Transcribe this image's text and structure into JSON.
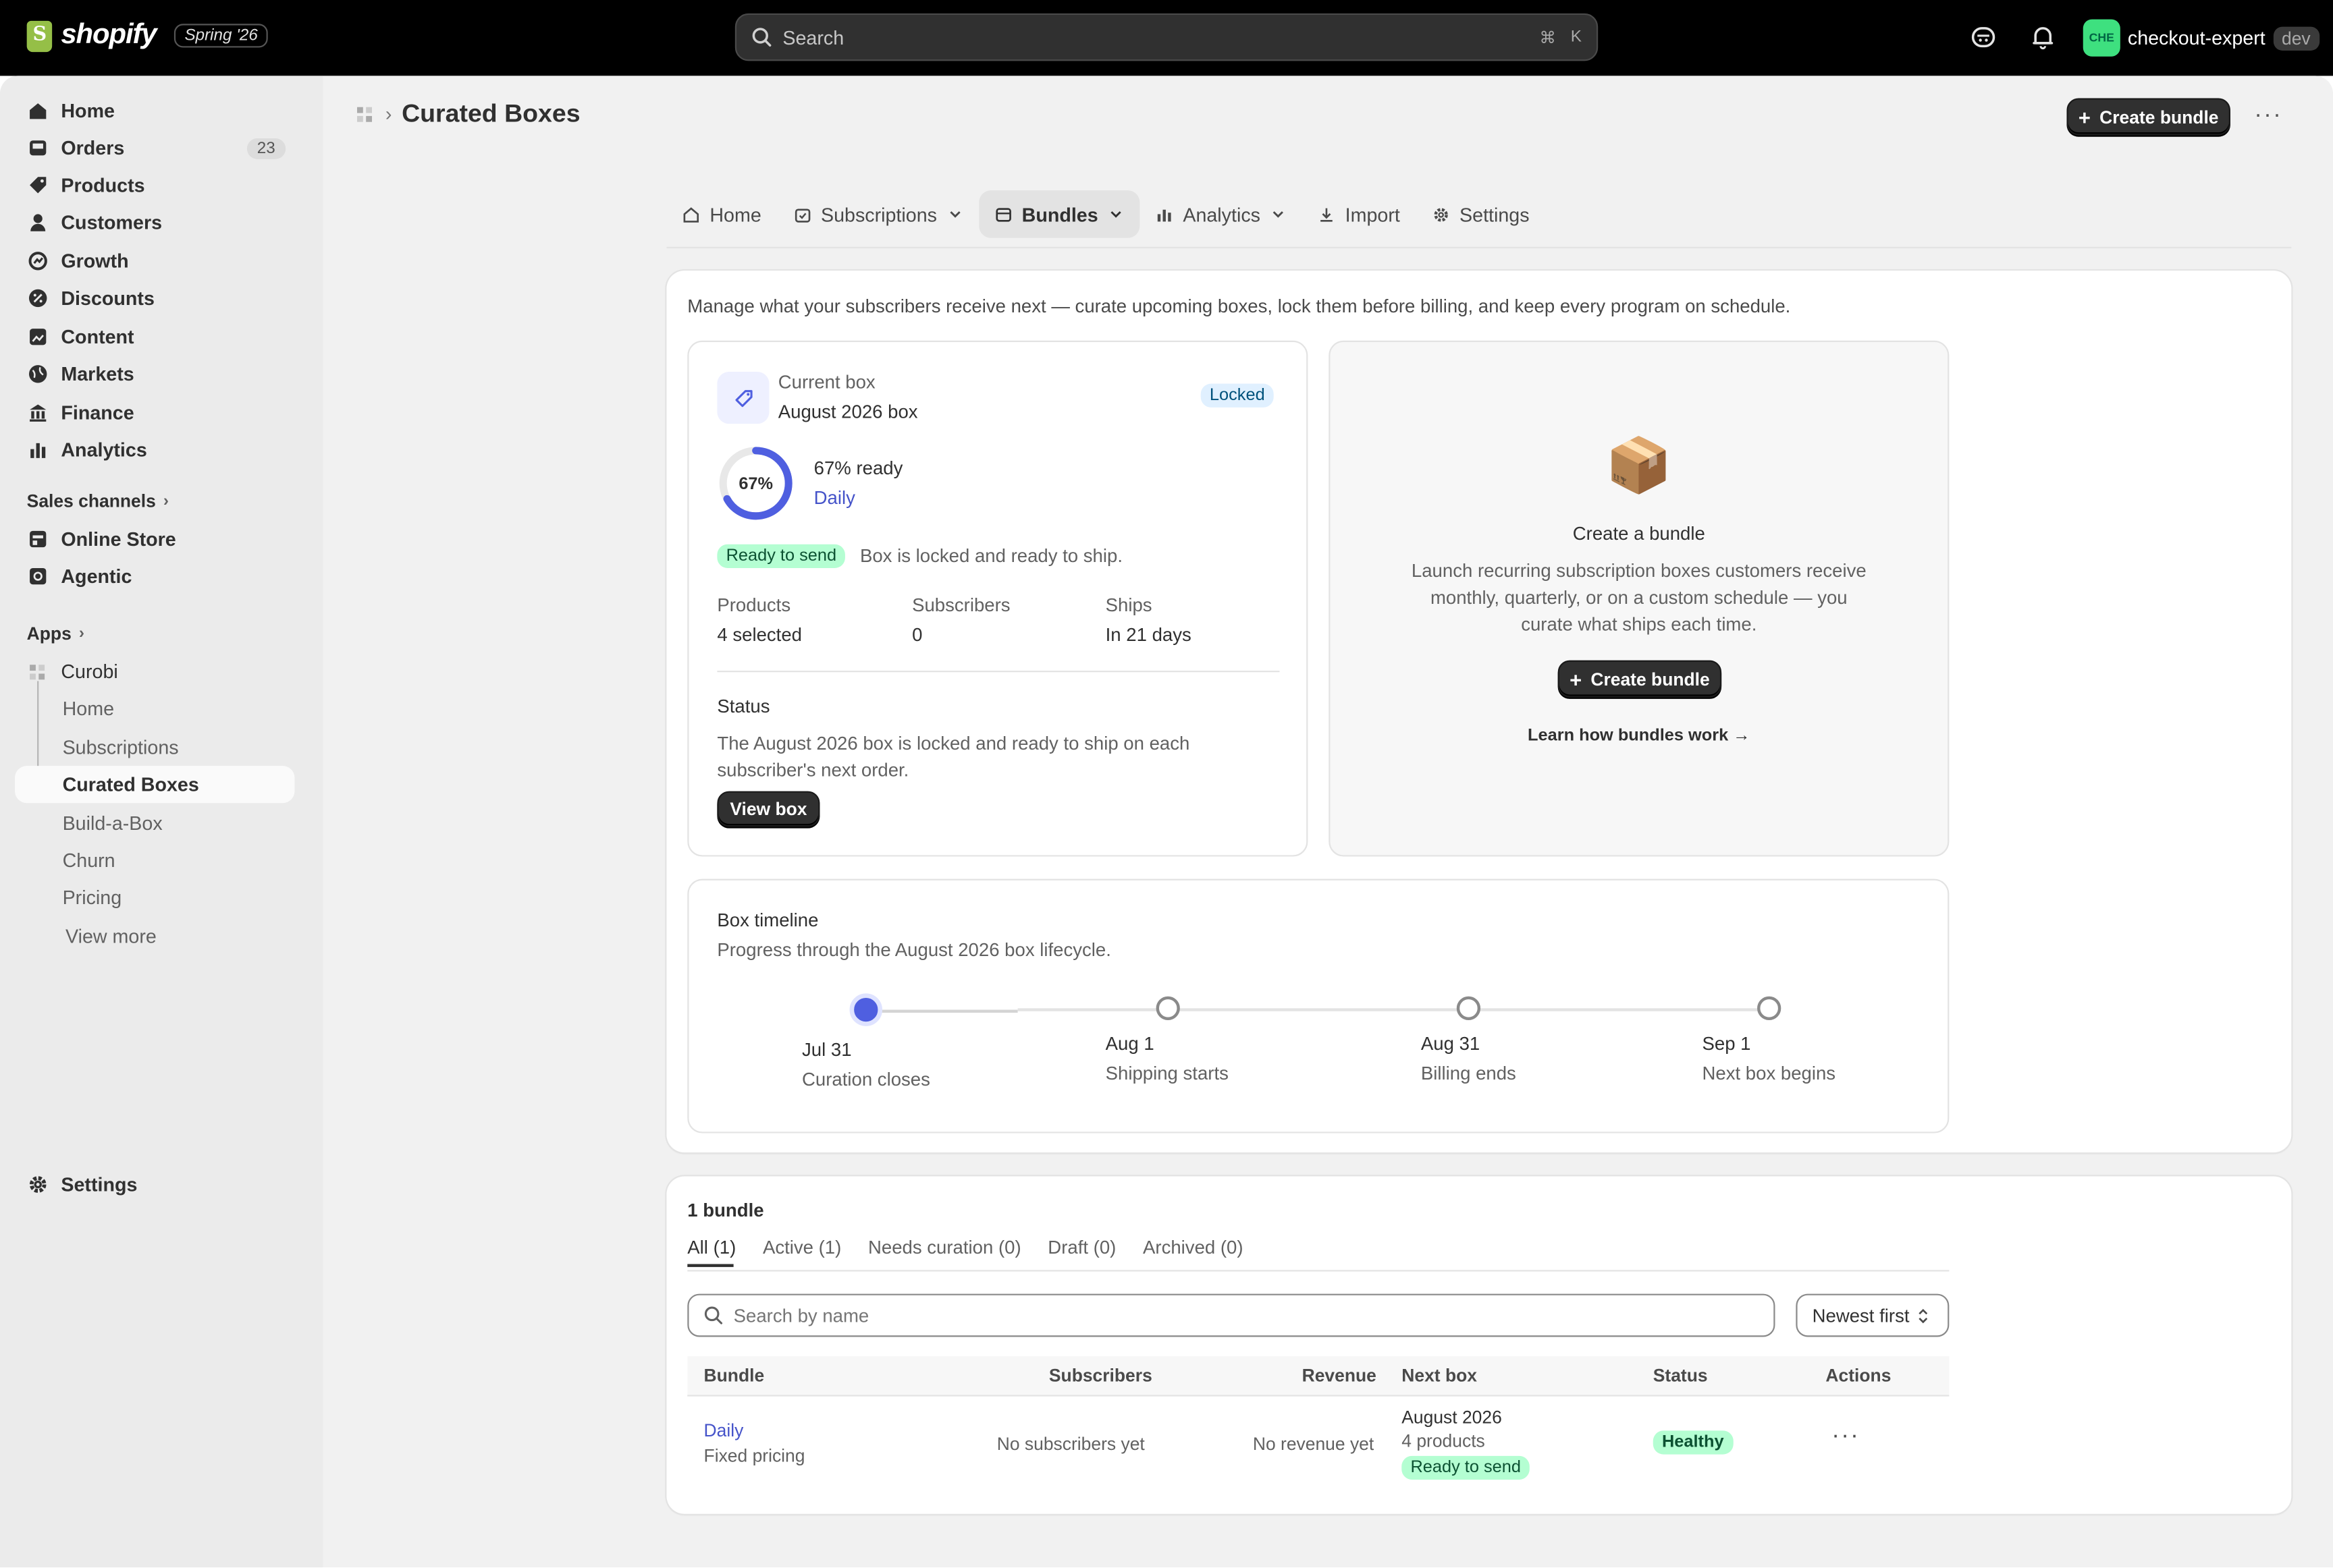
{
  "topbar": {
    "brand": "shopify",
    "release": "Spring '26",
    "search_placeholder": "Search",
    "shortcut_cmd": "⌘",
    "shortcut_key": "K",
    "store_avatar": "CHE",
    "store_name": "checkout-expert",
    "store_env": "dev"
  },
  "sidebar": {
    "items": [
      {
        "label": "Home",
        "icon": "home-icon"
      },
      {
        "label": "Orders",
        "icon": "inbox-icon",
        "badge": "23"
      },
      {
        "label": "Products",
        "icon": "tag-icon"
      },
      {
        "label": "Customers",
        "icon": "person-icon"
      },
      {
        "label": "Growth",
        "icon": "growth-icon"
      },
      {
        "label": "Discounts",
        "icon": "discount-icon"
      },
      {
        "label": "Content",
        "icon": "content-icon"
      },
      {
        "label": "Markets",
        "icon": "globe-icon"
      },
      {
        "label": "Finance",
        "icon": "bank-icon"
      },
      {
        "label": "Analytics",
        "icon": "bar-chart-icon"
      }
    ],
    "sales_channels_label": "Sales channels",
    "channels": [
      {
        "label": "Online Store",
        "icon": "store-icon"
      },
      {
        "label": "Agentic",
        "icon": "agentic-icon"
      }
    ],
    "apps_label": "Apps",
    "app_name": "Curobi",
    "app_items": [
      "Home",
      "Subscriptions",
      "Curated Boxes",
      "Build-a-Box",
      "Churn",
      "Pricing"
    ],
    "view_more": "View more",
    "settings": "Settings"
  },
  "header": {
    "title": "Curated Boxes",
    "create_button": "Create bundle"
  },
  "tabs": [
    {
      "label": "Home",
      "icon": "home-icon"
    },
    {
      "label": "Subscriptions",
      "icon": "subscriptions-icon",
      "dropdown": true
    },
    {
      "label": "Bundles",
      "icon": "bundle-icon",
      "dropdown": true
    },
    {
      "label": "Analytics",
      "icon": "bar-chart-icon",
      "dropdown": true
    },
    {
      "label": "Import",
      "icon": "download-icon"
    },
    {
      "label": "Settings",
      "icon": "gear-icon"
    }
  ],
  "intro": "Manage what your subscribers receive next — curate upcoming boxes, lock them before billing, and keep every program on schedule.",
  "current_box": {
    "eyebrow": "Current box",
    "name": "August 2026 box",
    "badge": "Locked",
    "percent_label": "67%",
    "percent_value": 0.67,
    "ready_text": "67% ready",
    "program_link": "Daily",
    "status_badge": "Ready to send",
    "status_message": "Box is locked and ready to ship.",
    "stats": [
      {
        "label": "Products",
        "value": "4 selected"
      },
      {
        "label": "Subscribers",
        "value": "0"
      },
      {
        "label": "Ships",
        "value": "In 21 days"
      }
    ],
    "status_heading": "Status",
    "status_body": "The August 2026 box is locked and ready to ship on each subscriber's next order.",
    "view_button": "View box"
  },
  "create_card": {
    "emoji": "📦",
    "title": "Create a bundle",
    "body": "Launch recurring subscription boxes customers receive monthly, quarterly, or on a custom schedule — you curate what ships each time.",
    "button": "Create bundle",
    "link": "Learn how bundles work →"
  },
  "timeline": {
    "title": "Box timeline",
    "subtitle": "Progress through the August 2026 box lifecycle.",
    "steps": [
      {
        "date": "Jul 31",
        "label": "Curation closes"
      },
      {
        "date": "Aug 1",
        "label": "Shipping starts"
      },
      {
        "date": "Aug 31",
        "label": "Billing ends"
      },
      {
        "date": "Sep 1",
        "label": "Next box begins"
      }
    ]
  },
  "bundles": {
    "count_label": "1 bundle",
    "filters": [
      "All (1)",
      "Active (1)",
      "Needs curation (0)",
      "Draft (0)",
      "Archived (0)"
    ],
    "search_placeholder": "Search by name",
    "sort": "Newest first",
    "columns": [
      "Bundle",
      "Subscribers",
      "Revenue",
      "Next box",
      "Status",
      "Actions"
    ],
    "rows": [
      {
        "name": "Daily",
        "pricing": "Fixed pricing",
        "subscribers": "No subscribers yet",
        "revenue": "No revenue yet",
        "next_box": "August 2026",
        "next_box_products": "4 products",
        "next_box_status": "Ready to send",
        "status": "Healthy"
      }
    ]
  }
}
